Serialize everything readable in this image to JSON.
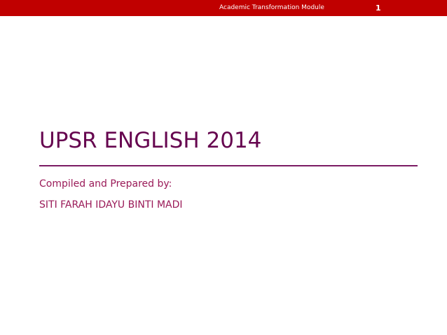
{
  "header": {
    "module_title": "Academic Transformation Module",
    "slide_number": "1"
  },
  "slide": {
    "title": "UPSR ENGLISH 2014",
    "subtitle_lines": [
      "Compiled and Prepared by:",
      "SITI FARAH IDAYU BINTI MADI"
    ]
  },
  "colors": {
    "header_background": "#c00000",
    "title_color": "#66064f",
    "subtitle_color": "#9a1a58"
  }
}
